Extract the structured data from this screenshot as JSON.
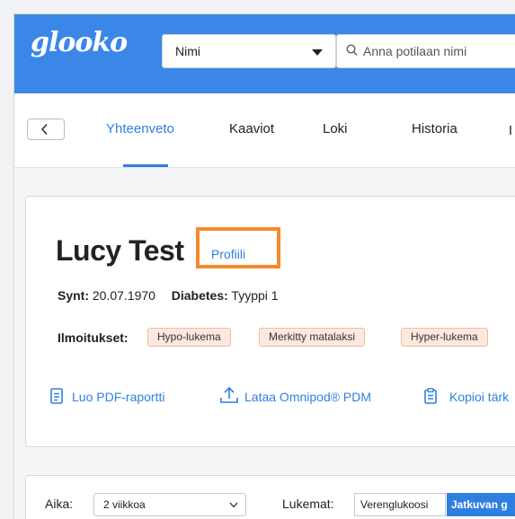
{
  "header": {
    "logo": "glooko",
    "name_select": {
      "value": "Nimi"
    },
    "search": {
      "placeholder": "Anna potilaan nimi"
    }
  },
  "nav": {
    "tabs": [
      {
        "label": "Yhteenveto",
        "active": true
      },
      {
        "label": "Kaaviot"
      },
      {
        "label": "Loki"
      },
      {
        "label": "Historia"
      }
    ]
  },
  "patient": {
    "name": "Lucy Test",
    "profile_link": "Profiili",
    "birth_label": "Synt:",
    "birth_date": "20.07.1970",
    "diabetes_label": "Diabetes:",
    "diabetes_type": "Tyyppi 1",
    "alerts_label": "Ilmoitukset:",
    "alerts": [
      "Hypo-lukema",
      "Merkitty matalaksi",
      "Hyper-lukema"
    ]
  },
  "actions": [
    {
      "label": "Luo PDF-raportti",
      "icon": "document-icon"
    },
    {
      "label": "Lataa Omnipod® PDM",
      "icon": "upload-icon"
    },
    {
      "label": "Kopioi tärk",
      "icon": "clipboard-icon"
    }
  ],
  "filters": {
    "aika_label": "Aika:",
    "aika_value": "2 viikkoa",
    "lukemat_label": "Lukemat:",
    "lukemat_options": [
      "Verenglukoosi",
      "Jatkuvan g"
    ]
  },
  "colors": {
    "brand_blue": "#3b87e8",
    "link_blue": "#2f7fe0",
    "highlight_orange": "#f58a2b",
    "tag_bg": "#fde8de"
  }
}
